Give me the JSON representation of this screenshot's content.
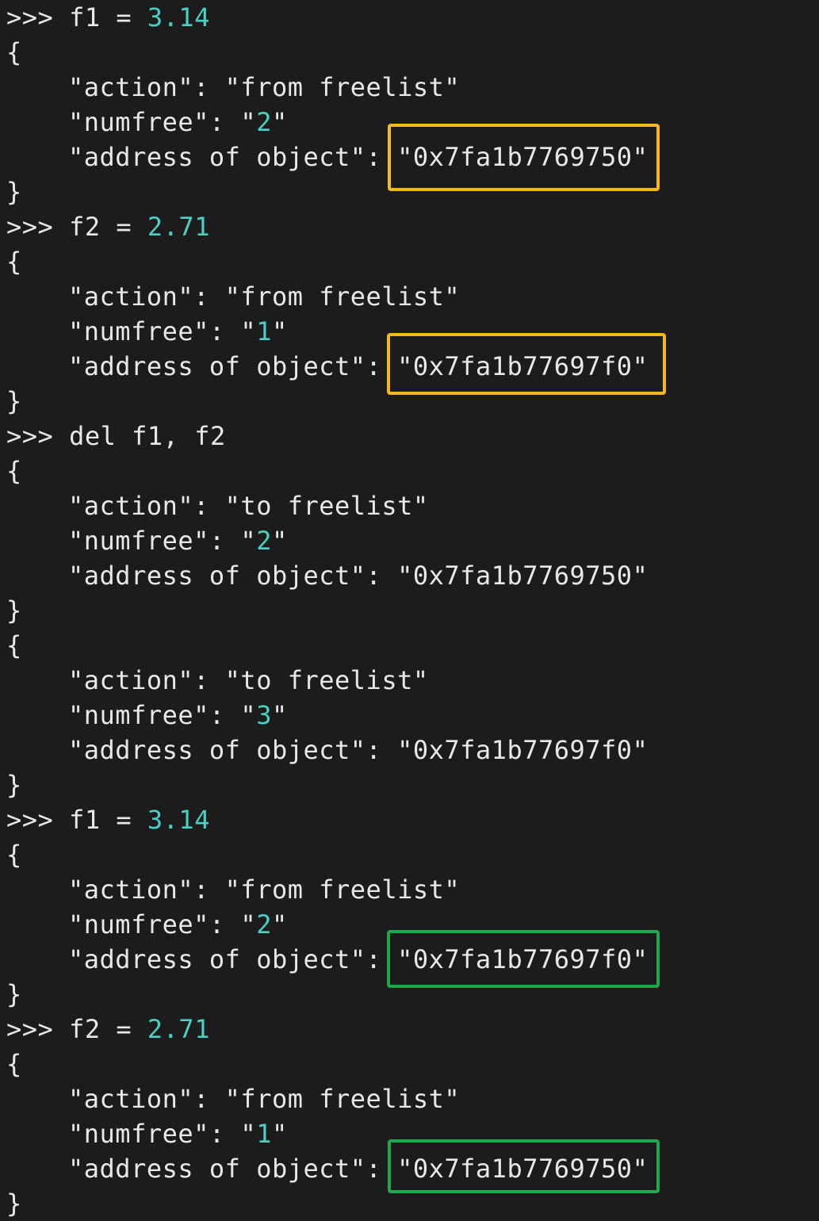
{
  "prompt": ">>>",
  "commands": [
    {
      "text": "f1 = ",
      "num": "3.14"
    },
    {
      "text": "f2 = ",
      "num": "2.71"
    },
    {
      "text": "del f1, f2",
      "num": ""
    },
    {
      "text": "f1 = ",
      "num": "3.14"
    },
    {
      "text": "f2 = ",
      "num": "2.71"
    }
  ],
  "braces": {
    "open": "{",
    "close": "}"
  },
  "keys": {
    "action": "\"action\": ",
    "numfree": "\"numfree\": ",
    "address": "\"address of object\": "
  },
  "blocks": [
    {
      "action": "\"from freelist\"",
      "numfree_q": "\"",
      "numfree": "2",
      "address": "\"0x7fa1b7769750\"",
      "highlight": "yellow"
    },
    {
      "action": "\"from freelist\"",
      "numfree_q": "\"",
      "numfree": "1",
      "address": "\"0x7fa1b77697f0\"",
      "highlight": "yellow"
    },
    {
      "action": "\"to freelist\"",
      "numfree_q": "\"",
      "numfree": "2",
      "address": "\"0x7fa1b7769750\"",
      "highlight": ""
    },
    {
      "action": "\"to freelist\"",
      "numfree_q": "\"",
      "numfree": "3",
      "address": "\"0x7fa1b77697f0\"",
      "highlight": ""
    },
    {
      "action": "\"from freelist\"",
      "numfree_q": "\"",
      "numfree": "2",
      "address": "\"0x7fa1b77697f0\"",
      "highlight": "green"
    },
    {
      "action": "\"from freelist\"",
      "numfree_q": "\"",
      "numfree": "1",
      "address": "\"0x7fa1b7769750\"",
      "highlight": "green"
    }
  ],
  "colors": {
    "background": "#1c1c1c",
    "text": "#e8e8e8",
    "number": "#48d1c6",
    "highlight_yellow": "#f5b81c",
    "highlight_green": "#1fa84a"
  }
}
